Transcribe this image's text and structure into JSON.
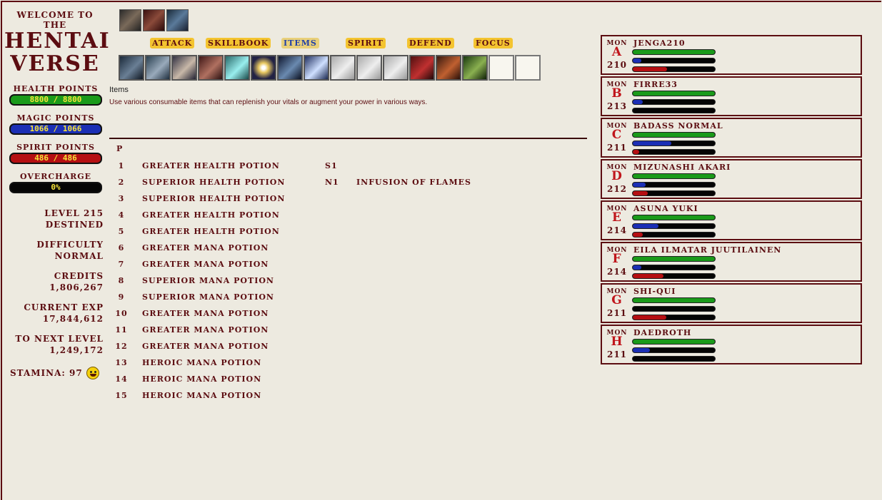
{
  "branding": {
    "welcome": "WELCOME TO THE",
    "line1": "HENTAI",
    "line2": "VERSE"
  },
  "vitals": {
    "health": {
      "label": "HEALTH POINTS",
      "value": "8800 / 8800"
    },
    "magic": {
      "label": "MAGIC POINTS",
      "value": "1066 / 1066"
    },
    "spirit": {
      "label": "SPIRIT POINTS",
      "value": "486 / 486"
    },
    "overcharge": {
      "label": "OVERCHARGE",
      "value": "0%"
    }
  },
  "stats": {
    "level": "LEVEL 215",
    "rank": "DESTINED",
    "difficulty_label": "DIFFICULTY",
    "difficulty": "NORMAL",
    "credits_label": "CREDITS",
    "credits": "1,806,267",
    "exp_label": "CURRENT EXP",
    "exp": "17,844,612",
    "next_label": "TO NEXT LEVEL",
    "next": "1,249,172",
    "stamina": "STAMINA: 97"
  },
  "effects": [
    "effect-icon",
    "effect-icon",
    "effect-icon"
  ],
  "tabs": [
    "ATTACK",
    "SKILLBOOK",
    "ITEMS",
    "SPIRIT",
    "DEFEND",
    "FOCUS"
  ],
  "active_tab": "ITEMS",
  "quickbar": {
    "filled_slots": 14,
    "empty_slots": 2
  },
  "panel": {
    "title": "Items",
    "description": "Use various consumable items that can replenish your vitals or augment your power in various ways.",
    "header": "P",
    "items": [
      {
        "num": "1",
        "name": "GREATER HEALTH POTION",
        "key": "S1",
        "infusion": ""
      },
      {
        "num": "2",
        "name": "SUPERIOR HEALTH POTION",
        "key": "N1",
        "infusion": "INFUSION OF FLAMES"
      },
      {
        "num": "3",
        "name": "SUPERIOR HEALTH POTION",
        "key": "",
        "infusion": ""
      },
      {
        "num": "4",
        "name": "GREATER HEALTH POTION",
        "key": "",
        "infusion": ""
      },
      {
        "num": "5",
        "name": "GREATER HEALTH POTION",
        "key": "",
        "infusion": ""
      },
      {
        "num": "6",
        "name": "GREATER MANA POTION",
        "key": "",
        "infusion": ""
      },
      {
        "num": "7",
        "name": "GREATER MANA POTION",
        "key": "",
        "infusion": ""
      },
      {
        "num": "8",
        "name": "SUPERIOR MANA POTION",
        "key": "",
        "infusion": ""
      },
      {
        "num": "9",
        "name": "SUPERIOR MANA POTION",
        "key": "",
        "infusion": ""
      },
      {
        "num": "10",
        "name": "GREATER MANA POTION",
        "key": "",
        "infusion": ""
      },
      {
        "num": "11",
        "name": "GREATER MANA POTION",
        "key": "",
        "infusion": ""
      },
      {
        "num": "12",
        "name": "GREATER MANA POTION",
        "key": "",
        "infusion": ""
      },
      {
        "num": "13",
        "name": "HEROIC MANA POTION",
        "key": "",
        "infusion": ""
      },
      {
        "num": "14",
        "name": "HEROIC MANA POTION",
        "key": "",
        "infusion": ""
      },
      {
        "num": "15",
        "name": "HEROIC MANA POTION",
        "key": "",
        "infusion": ""
      }
    ]
  },
  "monsters": [
    {
      "tag": "MON",
      "letter": "A",
      "name": "JENGA210",
      "level": "210",
      "health": 1.0,
      "mana": 0.1,
      "spirit": 0.42
    },
    {
      "tag": "MON",
      "letter": "B",
      "name": "FIRRE33",
      "level": "213",
      "health": 1.0,
      "mana": 0.12,
      "spirit": 0.0
    },
    {
      "tag": "MON",
      "letter": "C",
      "name": "BADASS NORMAL",
      "level": "211",
      "health": 1.0,
      "mana": 0.47,
      "spirit": 0.08
    },
    {
      "tag": "MON",
      "letter": "D",
      "name": "MIZUNASHI AKARI",
      "level": "212",
      "health": 1.0,
      "mana": 0.16,
      "spirit": 0.18
    },
    {
      "tag": "MON",
      "letter": "E",
      "name": "ASUNA YUKI",
      "level": "214",
      "health": 1.0,
      "mana": 0.31,
      "spirit": 0.12
    },
    {
      "tag": "MON",
      "letter": "F",
      "name": "EILA ILMATAR JUUTILAINEN",
      "level": "214",
      "health": 1.0,
      "mana": 0.1,
      "spirit": 0.37
    },
    {
      "tag": "MON",
      "letter": "G",
      "name": "SHI-QUI",
      "level": "211",
      "health": 1.0,
      "mana": 0.0,
      "spirit": 0.41
    },
    {
      "tag": "MON",
      "letter": "H",
      "name": "DAEDROTH",
      "level": "211",
      "health": 1.0,
      "mana": 0.21,
      "spirit": 0.0
    }
  ],
  "colors": {
    "accent": "#5C0D11",
    "background": "#EDEAE0",
    "health": "#1A9A1A",
    "mana": "#1B2FB5",
    "spirit": "#B50F12",
    "highlight": "#F4C430"
  }
}
